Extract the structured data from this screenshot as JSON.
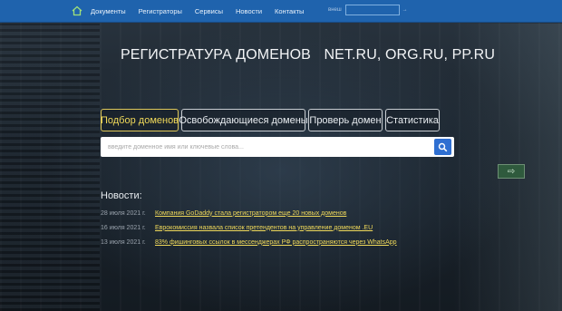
{
  "nav": {
    "items": [
      "Документы",
      "Регистраторы",
      "Сервисы",
      "Новости",
      "Контакты"
    ],
    "search_label": "внеш",
    "search_placeholder": "",
    "search_go": "→",
    "accent": "#1f63ad"
  },
  "hero": {
    "title": "РЕГИСТРАТУРА ДОМЕНОВ",
    "zones": "NET.RU, ORG.RU, PP.RU"
  },
  "tabs": [
    {
      "label": "Подбор доменов",
      "active": true
    },
    {
      "label": "Освобождающиеся домены",
      "active": false
    },
    {
      "label": "Проверь домен",
      "active": false
    },
    {
      "label": "Статистика",
      "active": false
    }
  ],
  "domain_search": {
    "placeholder": "введите доменное имя или ключевые слова..."
  },
  "news": {
    "title": "Новости:",
    "items": [
      {
        "date": "28 июля 2021 г.",
        "text": "Компания GoDaddy стала регистратором еще 20 новых доменов"
      },
      {
        "date": "16 июля 2021 г.",
        "text": "Еврокомиссия назвала список претендентов на управление доменом .EU"
      },
      {
        "date": "13 июля 2021 г.",
        "text": "83% фишинговых ссылок в мессенджерах РФ распространяются через WhatsApp"
      }
    ]
  },
  "colors": {
    "link": "#f0d95a",
    "active_tab": "#e0c95a",
    "button": "#2f6fd1"
  }
}
